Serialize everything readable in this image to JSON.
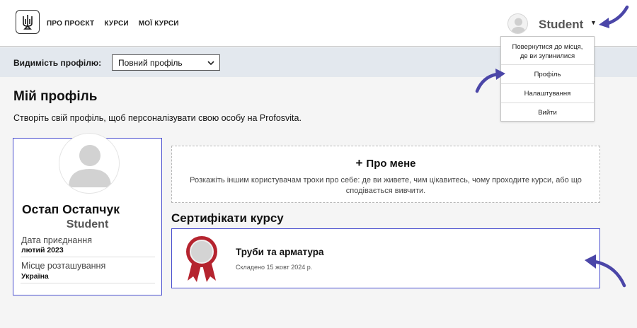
{
  "header": {
    "nav": [
      "ПРО ПРОЄКТ",
      "КУРСИ",
      "МОЇ КУРСИ"
    ],
    "username": "Student"
  },
  "visibility": {
    "label": "Видимість профілю:",
    "selected": "Повний профіль"
  },
  "page": {
    "title": "Мій профіль",
    "subtitle": "Створіть свій профіль, щоб персоналізувати свою особу на Profosvita."
  },
  "profile": {
    "full_name": "Остап Остапчук",
    "username": "Student",
    "joined_label": "Дата приєднання",
    "joined_value": "лютий 2023",
    "location_label": "Місце розташування",
    "location_value": "Україна"
  },
  "about": {
    "title": "Про мене",
    "text": "Розкажіть іншим користувачам трохи про себе: де ви живете, чим цікавитесь, чому проходите курси, або що сподівається вивчити."
  },
  "certificates": {
    "heading": "Сертифікати курсу",
    "items": [
      {
        "title": "Труби та арматура",
        "date": "Складено 15 жовт 2024 р."
      }
    ]
  },
  "dropdown": {
    "items": [
      "Повернутися до місця, де ви зупинилися",
      "Профіль",
      "Налаштування",
      "Вийти"
    ]
  },
  "colors": {
    "accent_border": "#4a4fcf",
    "annotation_arrow": "#4b46a8",
    "badge_red": "#b5242f",
    "visbar_bg": "#e3e8ee"
  },
  "icons": [
    "trident-logo-icon",
    "avatar-icon",
    "caret-down-icon",
    "chevron-down-icon",
    "plus-icon",
    "certificate-badge-icon",
    "annotation-arrow-icon"
  ]
}
